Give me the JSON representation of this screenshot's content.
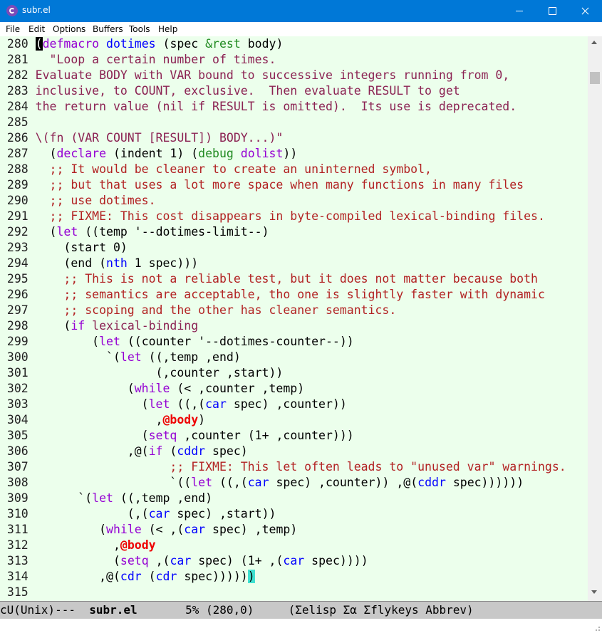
{
  "window": {
    "title": "subr.el",
    "app_icon": "emacs-icon"
  },
  "menu": [
    "File",
    "Edit",
    "Options",
    "Buffers",
    "Tools",
    "Help"
  ],
  "editor": {
    "lines": [
      {
        "n": "280",
        "segs": [
          [
            "cur",
            "("
          ],
          [
            "kw",
            "defmacro"
          ],
          [
            "",
            ""
          ],
          [
            "fn",
            " dotimes"
          ],
          [
            "",
            " (spec "
          ],
          [
            "dk",
            "&rest"
          ],
          [
            "",
            " body)"
          ]
        ]
      },
      {
        "n": "281",
        "segs": [
          [
            "st",
            "  \"Loop a certain number of times."
          ]
        ]
      },
      {
        "n": "282",
        "segs": [
          [
            "st",
            "Evaluate BODY with VAR bound to successive integers running from 0,"
          ]
        ]
      },
      {
        "n": "283",
        "segs": [
          [
            "st",
            "inclusive, to COUNT, exclusive.  Then evaluate RESULT to get"
          ]
        ]
      },
      {
        "n": "284",
        "segs": [
          [
            "st",
            "the return value (nil if RESULT is omitted).  Its use is deprecated."
          ]
        ]
      },
      {
        "n": "285",
        "segs": []
      },
      {
        "n": "286",
        "segs": [
          [
            "st",
            "\\(fn (VAR COUNT [RESULT]) BODY...)\""
          ]
        ]
      },
      {
        "n": "287",
        "segs": [
          [
            "",
            "  ("
          ],
          [
            "kw",
            "declare"
          ],
          [
            "",
            " (indent 1) ("
          ],
          [
            "dk",
            "debug"
          ],
          [
            "",
            " "
          ],
          [
            "kw",
            "dolist"
          ],
          [
            "",
            "))"
          ]
        ]
      },
      {
        "n": "288",
        "segs": [
          [
            "cm",
            "  ;; It would be cleaner to create an uninterned symbol,"
          ]
        ]
      },
      {
        "n": "289",
        "segs": [
          [
            "cm",
            "  ;; but that uses a lot more space when many functions in many files"
          ]
        ]
      },
      {
        "n": "290",
        "segs": [
          [
            "cm",
            "  ;; use dotimes."
          ]
        ]
      },
      {
        "n": "291",
        "segs": [
          [
            "cm",
            "  ;; FIXME: This cost disappears in byte-compiled lexical-binding files."
          ]
        ]
      },
      {
        "n": "292",
        "segs": [
          [
            "",
            "  ("
          ],
          [
            "kw",
            "let"
          ],
          [
            "",
            " ((temp '--dotimes-limit--)"
          ]
        ]
      },
      {
        "n": "293",
        "segs": [
          [
            "",
            "    (start 0)"
          ]
        ]
      },
      {
        "n": "294",
        "segs": [
          [
            "",
            "    (end ("
          ],
          [
            "bi",
            "nth"
          ],
          [
            "",
            " 1 spec)))"
          ]
        ]
      },
      {
        "n": "295",
        "segs": [
          [
            "cm",
            "    ;; This is not a reliable test, but it does not matter because both"
          ]
        ]
      },
      {
        "n": "296",
        "segs": [
          [
            "cm",
            "    ;; semantics are acceptable, tho one is slightly faster with dynamic"
          ]
        ]
      },
      {
        "n": "297",
        "segs": [
          [
            "cm",
            "    ;; scoping and the other has cleaner semantics."
          ]
        ]
      },
      {
        "n": "298",
        "segs": [
          [
            "",
            "    ("
          ],
          [
            "kw",
            "if"
          ],
          [
            "",
            " "
          ],
          [
            "st",
            "lexical-binding"
          ]
        ]
      },
      {
        "n": "299",
        "segs": [
          [
            "",
            "        ("
          ],
          [
            "kw",
            "let"
          ],
          [
            "",
            " ((counter '--dotimes-counter--))"
          ]
        ]
      },
      {
        "n": "300",
        "segs": [
          [
            "",
            "          `("
          ],
          [
            "kw",
            "let"
          ],
          [
            "",
            " ((,temp ,end)"
          ]
        ]
      },
      {
        "n": "301",
        "segs": [
          [
            "",
            "                 (,counter ,start))"
          ]
        ]
      },
      {
        "n": "302",
        "segs": [
          [
            "",
            "             ("
          ],
          [
            "kw",
            "while"
          ],
          [
            "",
            " (< ,counter ,temp)"
          ]
        ]
      },
      {
        "n": "303",
        "segs": [
          [
            "",
            "               ("
          ],
          [
            "kw",
            "let"
          ],
          [
            "",
            " ((,("
          ],
          [
            "bi",
            "car"
          ],
          [
            "",
            " spec) ,counter))"
          ]
        ]
      },
      {
        "n": "304",
        "segs": [
          [
            "",
            "                 ,"
          ],
          [
            "ab",
            "@body"
          ],
          [
            "",
            ")"
          ]
        ]
      },
      {
        "n": "305",
        "segs": [
          [
            "",
            "               ("
          ],
          [
            "kw",
            "setq"
          ],
          [
            "",
            " ,counter (1+ ,counter)))"
          ]
        ]
      },
      {
        "n": "306",
        "segs": [
          [
            "",
            "             ,@("
          ],
          [
            "kw",
            "if"
          ],
          [
            "",
            " ("
          ],
          [
            "bi",
            "cddr"
          ],
          [
            "",
            " spec)"
          ]
        ]
      },
      {
        "n": "307",
        "segs": [
          [
            "cm",
            "                   ;; FIXME: This let often leads to \"unused var\" warnings."
          ]
        ]
      },
      {
        "n": "308",
        "segs": [
          [
            "",
            "                   `(("
          ],
          [
            "kw",
            "let"
          ],
          [
            "",
            " ((,("
          ],
          [
            "bi",
            "car"
          ],
          [
            "",
            " spec) ,counter)) ,@("
          ],
          [
            "bi",
            "cddr"
          ],
          [
            "",
            " spec))))))"
          ]
        ]
      },
      {
        "n": "309",
        "segs": [
          [
            "",
            "      `("
          ],
          [
            "kw",
            "let"
          ],
          [
            "",
            " ((,temp ,end)"
          ]
        ]
      },
      {
        "n": "310",
        "segs": [
          [
            "",
            "             (,("
          ],
          [
            "bi",
            "car"
          ],
          [
            "",
            " spec) ,start))"
          ]
        ]
      },
      {
        "n": "311",
        "segs": [
          [
            "",
            "         ("
          ],
          [
            "kw",
            "while"
          ],
          [
            "",
            " (< ,("
          ],
          [
            "bi",
            "car"
          ],
          [
            "",
            " spec) ,temp)"
          ]
        ]
      },
      {
        "n": "312",
        "segs": [
          [
            "",
            "           ,"
          ],
          [
            "ab",
            "@body"
          ]
        ]
      },
      {
        "n": "313",
        "segs": [
          [
            "",
            "           ("
          ],
          [
            "kw",
            "setq"
          ],
          [
            "",
            " ,("
          ],
          [
            "bi",
            "car"
          ],
          [
            "",
            " spec) (1+ ,("
          ],
          [
            "bi",
            "car"
          ],
          [
            "",
            " spec))))"
          ]
        ]
      },
      {
        "n": "314",
        "segs": [
          [
            "",
            "         ,@("
          ],
          [
            "bi",
            "cdr"
          ],
          [
            "",
            " ("
          ],
          [
            "bi",
            "cdr"
          ],
          [
            "",
            " spec)))))"
          ],
          [
            "paren",
            ")"
          ]
        ]
      },
      {
        "n": "315",
        "segs": []
      }
    ]
  },
  "modeline": {
    "status": "cU(Unix)---  ",
    "buffer": "subr.el",
    "position": "       5% (280,0)     ",
    "modes": "(Σelisp Σα Σflykeys Abbrev)"
  },
  "colors": {
    "title_bg": "#0078d7",
    "editor_bg": "#ecffec",
    "keyword": "#9400d3",
    "function": "#0000ff",
    "comment": "#b22222",
    "string": "#8b2252"
  }
}
